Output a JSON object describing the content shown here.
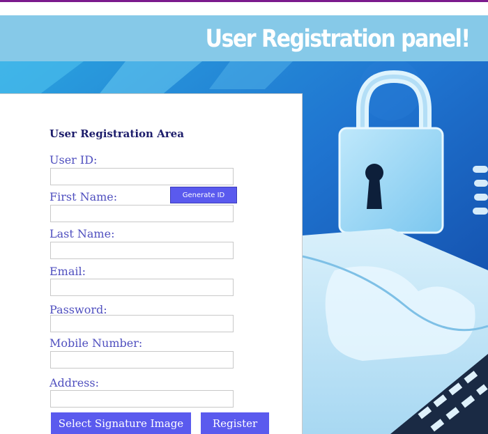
{
  "banner": {
    "title": "User Registration panel!"
  },
  "form": {
    "section_title": "User Registration Area",
    "fields": [
      {
        "label": "User ID:",
        "value": ""
      },
      {
        "label": "First Name:",
        "value": ""
      },
      {
        "label": "Last Name:",
        "value": ""
      },
      {
        "label": "Email:",
        "value": ""
      },
      {
        "label": "Password:",
        "value": ""
      },
      {
        "label": "Mobile Number:",
        "value": ""
      },
      {
        "label": "Address:",
        "value": ""
      }
    ],
    "generate_id_label": "Generate ID",
    "select_signature_label": "Select Signature Image",
    "register_label": "Register"
  },
  "colors": {
    "banner": "#86c9e8",
    "accent_button": "#5a5aee",
    "label_text": "#4f4fbf",
    "top_strip": "#7b1a8c"
  },
  "icons": [
    "padlock-illustration",
    "laptop-illustration"
  ]
}
